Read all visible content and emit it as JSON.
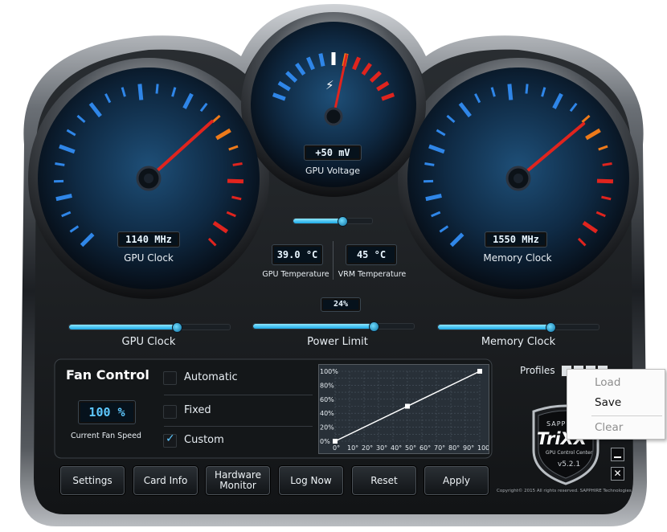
{
  "gauges": {
    "gpu_clock": {
      "readout": "1140 MHz",
      "label": "GPU Clock"
    },
    "gpu_voltage": {
      "readout": "+50 mV",
      "label": "GPU Voltage"
    },
    "memory_clock": {
      "readout": "1550 MHz",
      "label": "Memory Clock"
    }
  },
  "temps": {
    "gpu_temp": {
      "readout": "39.0 °C",
      "label": "GPU Temperature"
    },
    "vrm_temp": {
      "readout": "45 °C",
      "label": "VRM Temperature"
    }
  },
  "voltage_slider": {
    "level": 0.62
  },
  "power_limit_readout": "24%",
  "sliders": [
    {
      "label": "GPU Clock",
      "level": 0.67
    },
    {
      "label": "Power Limit",
      "level": 0.75
    },
    {
      "label": "Memory Clock",
      "level": 0.7
    }
  ],
  "fan_control": {
    "title": "Fan Control",
    "speed_readout": "100 %",
    "speed_label": "Current Fan Speed",
    "options": [
      {
        "label": "Automatic",
        "checked": false
      },
      {
        "label": "Fixed",
        "checked": false
      },
      {
        "label": "Custom",
        "checked": true
      }
    ],
    "curve": {
      "y_ticks": [
        "100%",
        "80%",
        "60%",
        "40%",
        "20%",
        "0%"
      ],
      "x_ticks": [
        "0°",
        "10°",
        "20°",
        "30°",
        "40°",
        "50°",
        "60°",
        "70°",
        "80°",
        "90°",
        "100°"
      ],
      "points": [
        [
          0,
          0
        ],
        [
          50,
          50
        ],
        [
          100,
          100
        ]
      ]
    }
  },
  "profiles": {
    "label": "Profiles",
    "menu": {
      "load": "Load",
      "save": "Save",
      "clear": "Clear"
    }
  },
  "brand": {
    "logo_top": "SAPPHIRE",
    "logo_main": "TriXX",
    "logo_sub": "GPU Control Center",
    "version": "v5.2.1"
  },
  "buttons": {
    "settings": "Settings",
    "card_info": "Card Info",
    "hardware_monitor_1": "Hardware",
    "hardware_monitor_2": "Monitor",
    "log_now": "Log Now",
    "reset": "Reset",
    "apply": "Apply"
  },
  "copyright": "Copyright© 2015 All rights reserved. SAPPHIRE Technologies",
  "colors": {
    "accent": "#1aa8e6",
    "needle": "#e0241e",
    "tick_blue": "#2f86e8",
    "tick_red": "#e0241e",
    "tick_orange": "#ee7a1a"
  }
}
